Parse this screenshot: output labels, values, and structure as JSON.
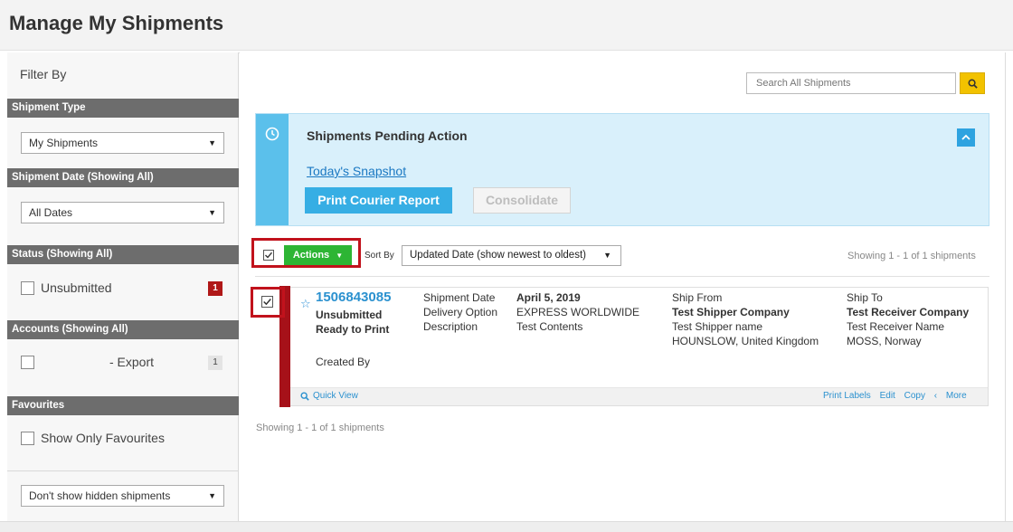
{
  "page": {
    "title": "Manage My Shipments"
  },
  "sidebar": {
    "filter_by": "Filter By",
    "shipment_type": {
      "header": "Shipment Type",
      "select_value": "My Shipments"
    },
    "shipment_date": {
      "header": "Shipment Date (Showing All)",
      "select_value": "All Dates"
    },
    "status": {
      "header": "Status (Showing All)",
      "option_label": "Unsubmitted",
      "count": "1"
    },
    "accounts": {
      "header": "Accounts (Showing All)",
      "option_label": "- Export",
      "count": "1"
    },
    "favourites": {
      "header": "Favourites",
      "option_label": "Show Only Favourites"
    },
    "hidden_select_value": "Don't show hidden shipments"
  },
  "search": {
    "placeholder": "Search All Shipments",
    "icon": "search-icon"
  },
  "pending": {
    "title": "Shipments Pending Action",
    "snapshot_link": "Today's Snapshot",
    "print_button": "Print Courier Report",
    "consolidate_button": "Consolidate",
    "icon": "clock-icon",
    "accent_color": "#5bc0eb",
    "background_color": "#d9f0fb"
  },
  "toolbar": {
    "actions_button": "Actions",
    "sort_label": "Sort By",
    "sort_value": "Updated Date (show newest to oldest)",
    "showing_text": "Showing 1 - 1 of 1 shipments",
    "actions_color": "#2db534"
  },
  "shipment": {
    "id": "1506843085",
    "status_line1": "Unsubmitted",
    "status_line2": "Ready to Print",
    "created_by_label": "Created By",
    "labels": {
      "date": "Shipment Date",
      "delivery": "Delivery Option",
      "description": "Description"
    },
    "values": {
      "date": "April 5, 2019",
      "delivery": "EXPRESS WORLDWIDE",
      "description": "Test Contents"
    },
    "ship_from": {
      "label": "Ship From",
      "company": "Test Shipper Company",
      "name": "Test Shipper name",
      "location": "HOUNSLOW, United Kingdom"
    },
    "ship_to": {
      "label": "Ship To",
      "company": "Test Receiver Company",
      "name": "Test Receiver Name",
      "location": "MOSS, Norway"
    },
    "quick_view": "Quick View",
    "links": {
      "print_labels": "Print Labels",
      "edit": "Edit",
      "copy": "Copy",
      "more": "More"
    },
    "highlight_color": "#c1121c"
  },
  "footer": {
    "showing_text": "Showing 1 - 1 of 1 shipments"
  }
}
